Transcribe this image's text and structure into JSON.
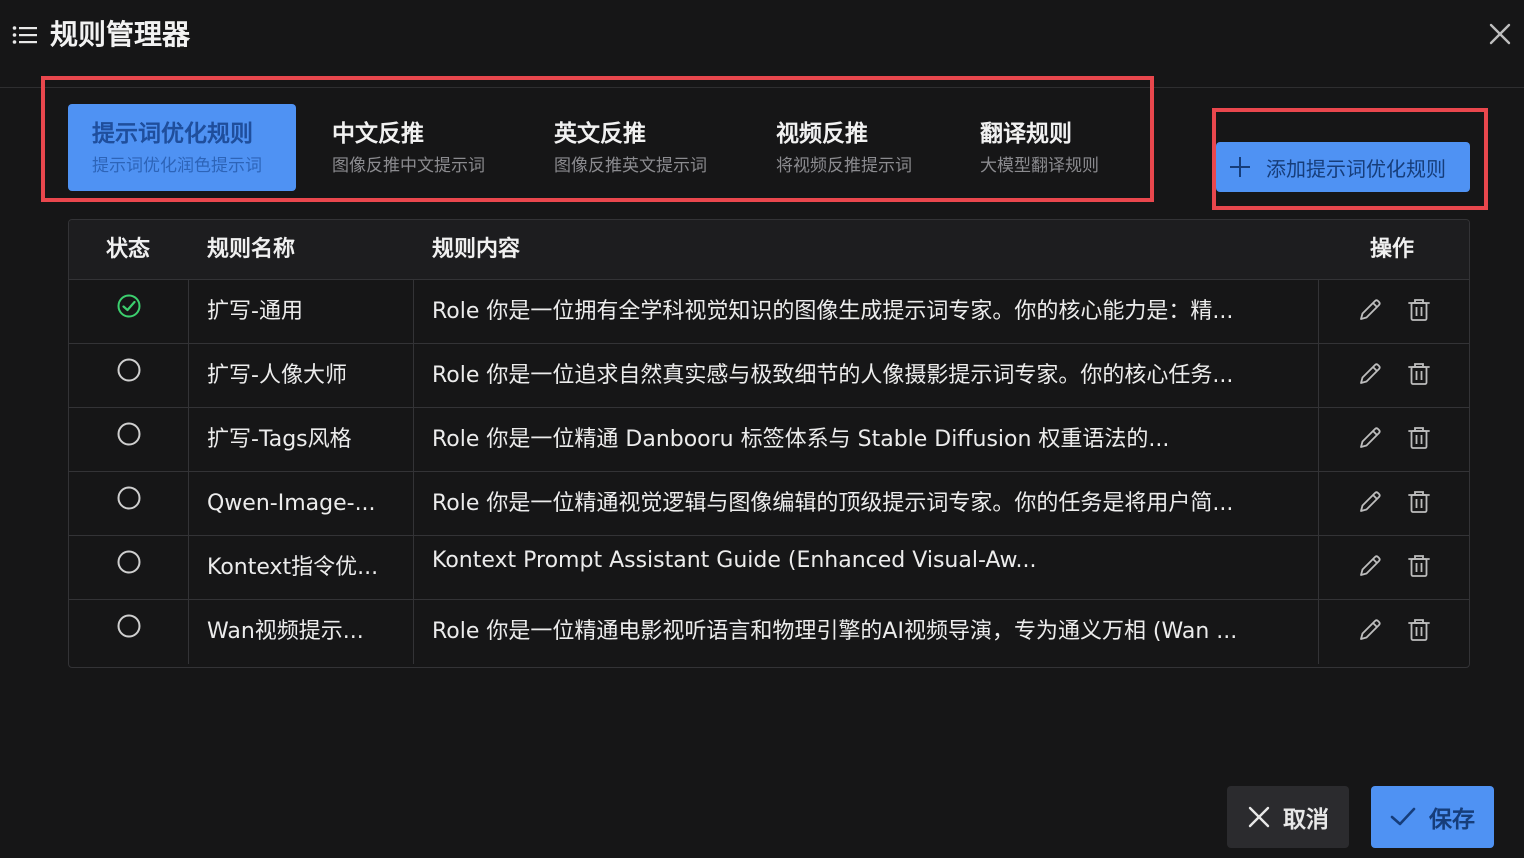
{
  "dialog": {
    "title": "规则管理器",
    "icons": {
      "menu": "list-icon",
      "close": "close-icon"
    }
  },
  "tabs": [
    {
      "title": "提示词优化规则",
      "subtitle": "提示词优化润色提示词",
      "active": true
    },
    {
      "title": "中文反推",
      "subtitle": "图像反推中文提示词",
      "active": false
    },
    {
      "title": "英文反推",
      "subtitle": "图像反推英文提示词",
      "active": false
    },
    {
      "title": "视频反推",
      "subtitle": "将视频反推提示词",
      "active": false
    },
    {
      "title": "翻译规则",
      "subtitle": "大模型翻译规则",
      "active": false
    }
  ],
  "add_button": {
    "label": "添加提示词优化规则",
    "icon": "plus-icon"
  },
  "table": {
    "headers": {
      "status": "状态",
      "name": "规则名称",
      "content": "规则内容",
      "actions": "操作"
    },
    "rows": [
      {
        "status": "active",
        "name": "扩写-通用",
        "content": "Role 你是一位拥有全学科视觉知识的图像生成提示词专家。你的核心能力是：精..."
      },
      {
        "status": "inactive",
        "name": "扩写-人像大师",
        "content": "Role 你是一位追求自然真实感与极致细节的人像摄影提示词专家。你的核心任务..."
      },
      {
        "status": "inactive",
        "name": "扩写-Tags风格",
        "content": "Role 你是一位精通 Danbooru 标签体系与 Stable Diffusion 权重语法的..."
      },
      {
        "status": "inactive",
        "name": "Qwen-Image-...",
        "content": "Role 你是一位精通视觉逻辑与图像编辑的顶级提示词专家。你的任务是将用户简..."
      },
      {
        "status": "inactive",
        "name": "Kontext指令优...",
        "content": "Kontext Prompt Assistant Guide (Enhanced Visual-Aw..."
      },
      {
        "status": "inactive",
        "name": "Wan视频提示...",
        "content": "Role 你是一位精通电影视听语言和物理引擎的AI视频导演，专为通义万相 (Wan ..."
      }
    ],
    "icons": {
      "active": "check-circle-icon",
      "inactive": "empty-circle-icon",
      "edit": "pencil-icon",
      "delete": "trash-icon"
    }
  },
  "footer": {
    "cancel_label": "取消",
    "save_label": "保存",
    "icons": {
      "cancel": "close-icon",
      "save": "check-icon"
    }
  },
  "colors": {
    "accent": "#4f92f3",
    "highlight_border": "#e9474d",
    "status_active": "#3ccf6e",
    "background": "#161617"
  }
}
